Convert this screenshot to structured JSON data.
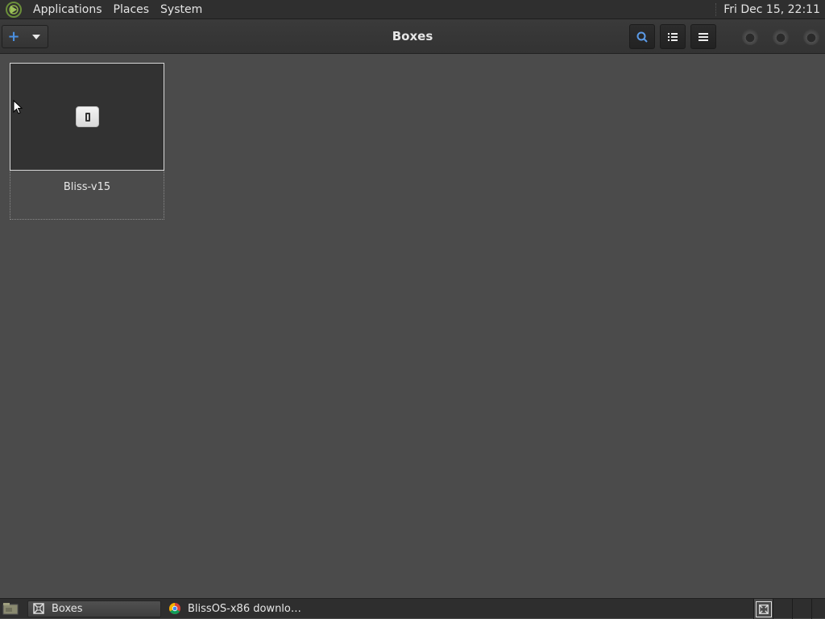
{
  "top_panel": {
    "menus": [
      "Applications",
      "Places",
      "System"
    ],
    "clock": "Fri Dec 15, 22:11"
  },
  "headerbar": {
    "title": "Boxes",
    "new_button_icon": "plus-icon",
    "accent_color": "#4a8fe0"
  },
  "boxes": [
    {
      "name": "Bliss-v15",
      "icon": "phone-icon"
    }
  ],
  "taskbar": {
    "tasks": [
      {
        "label": "Boxes",
        "icon": "boxes-app-icon",
        "active": true
      },
      {
        "label": "BlissOS-x86 downlo…",
        "icon": "chrome-icon",
        "active": false
      }
    ]
  }
}
